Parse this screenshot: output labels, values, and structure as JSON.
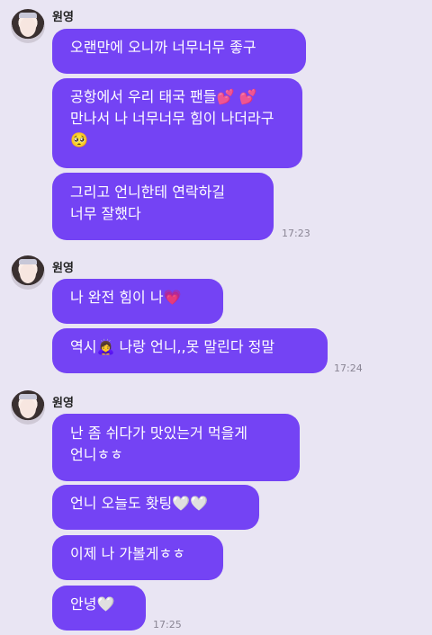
{
  "sender_name": "원영",
  "groups": [
    {
      "messages": [
        {
          "lines": [
            "오랜만에 오니까 너무너무 좋구"
          ]
        },
        {
          "lines": [
            "공항에서 우리 태국 팬들💕 💕",
            "만나서 나 너무너무 힘이 나더라구",
            "🥺"
          ]
        },
        {
          "lines": [
            "그리고 언니한테 연락하길",
            "너무 잘했다"
          ]
        }
      ],
      "time": "17:23"
    },
    {
      "messages": [
        {
          "lines": [
            "나 완전 힘이 나💗"
          ]
        },
        {
          "lines": [
            "역시🙇‍♀️ 나랑 언니,,못 말린다 정말"
          ]
        }
      ],
      "time": "17:24"
    },
    {
      "messages": [
        {
          "lines": [
            "난 좀 쉬다가 맛있는거 먹을게",
            "언니ㅎㅎ"
          ]
        },
        {
          "lines": [
            "언니 오늘도 홧팅🤍🤍"
          ]
        },
        {
          "lines": [
            "이제 나 가볼게ㅎㅎ"
          ]
        },
        {
          "lines": [
            "안녕🤍"
          ]
        }
      ],
      "time": "17:25"
    }
  ],
  "colors": {
    "bubble": "#7443f4",
    "background": "#e9e5f3",
    "time": "#8a8594"
  }
}
